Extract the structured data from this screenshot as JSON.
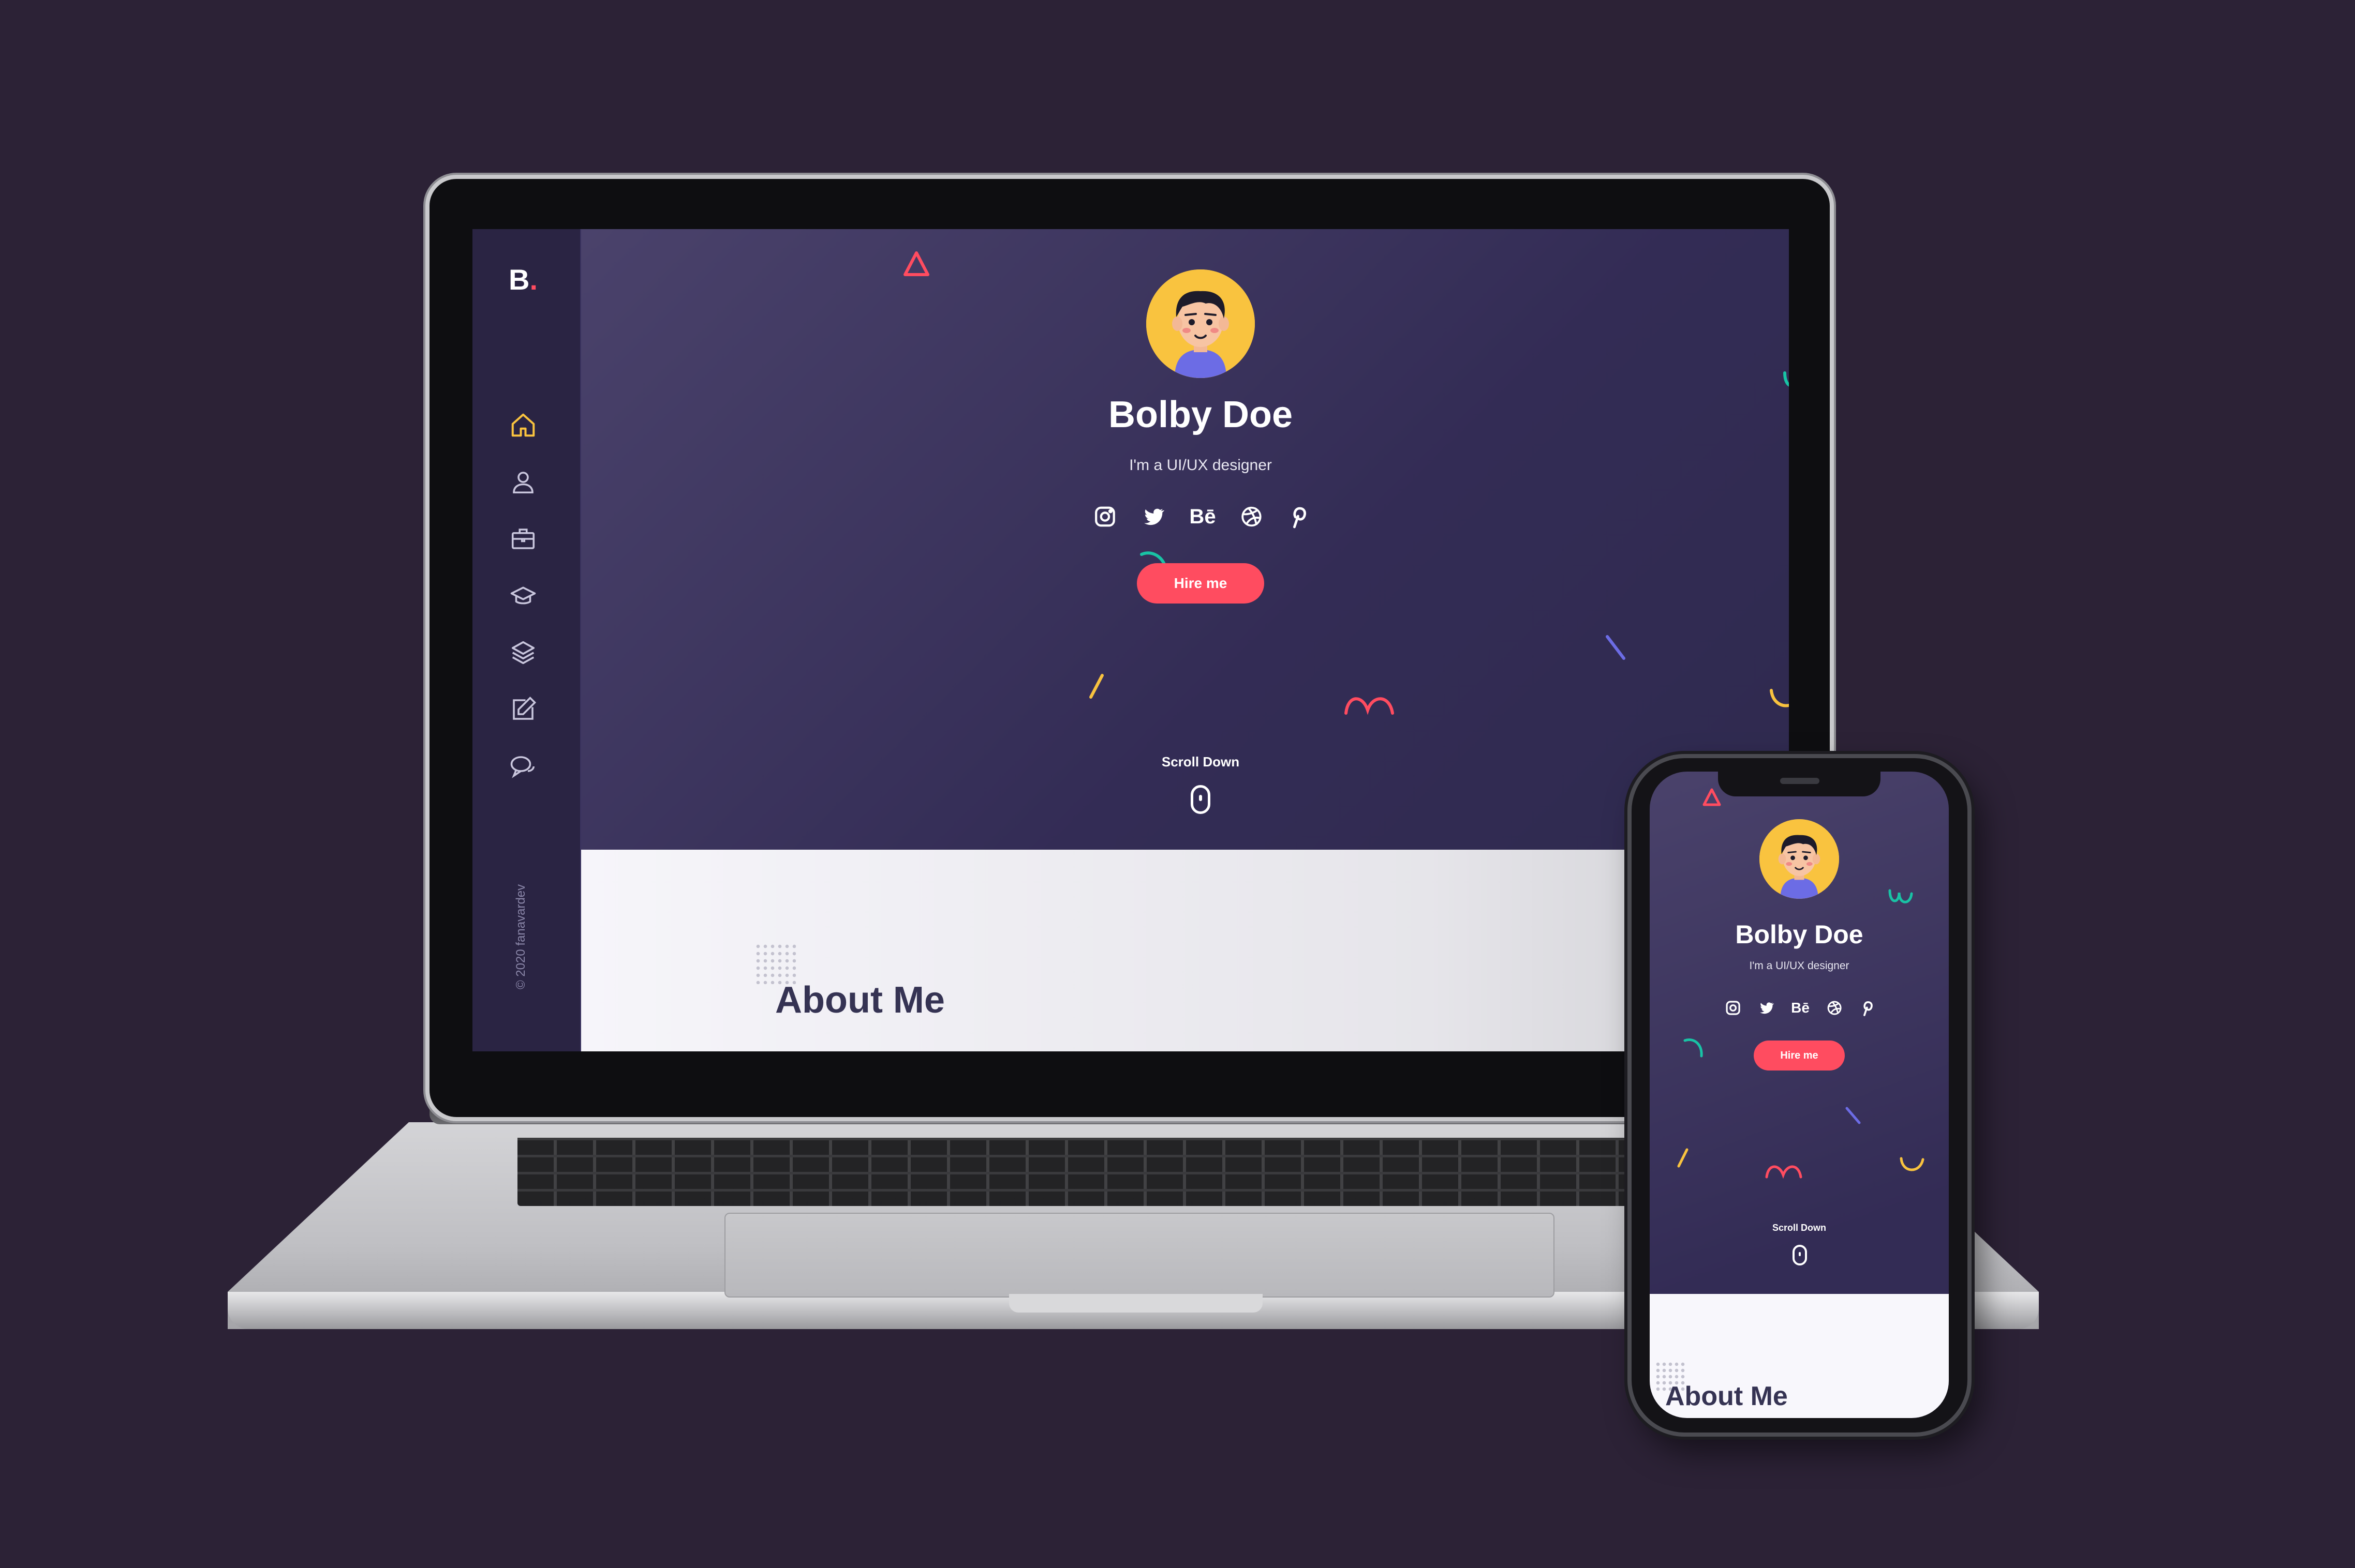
{
  "site": {
    "logo": "B",
    "logo_dot": ".",
    "copyright": "© 2020 fanavardev",
    "nav": [
      {
        "id": "home",
        "icon": "home-icon"
      },
      {
        "id": "about",
        "icon": "user-icon"
      },
      {
        "id": "services",
        "icon": "briefcase-icon"
      },
      {
        "id": "experience",
        "icon": "graduation-cap-icon"
      },
      {
        "id": "works",
        "icon": "layers-icon"
      },
      {
        "id": "blog",
        "icon": "edit-icon"
      },
      {
        "id": "contact",
        "icon": "chat-icon"
      }
    ],
    "hero": {
      "name": "Bolby Doe",
      "subtitle": "I'm a UI/UX designer",
      "social": [
        {
          "id": "instagram",
          "icon": "instagram-icon"
        },
        {
          "id": "twitter",
          "icon": "twitter-icon"
        },
        {
          "id": "behance",
          "icon": "behance-icon",
          "text": "Bē"
        },
        {
          "id": "dribbble",
          "icon": "dribbble-icon"
        },
        {
          "id": "pinterest",
          "icon": "pinterest-icon"
        }
      ],
      "hire_button": "Hire me",
      "scroll_label": "Scroll Down"
    },
    "about_title": "About Me"
  },
  "colors": {
    "background": "#2c2236",
    "accent": "#ff4c60",
    "hero_bg": "#332c55",
    "avatar_bg": "#f9c33f",
    "shape_teal": "#19c3a5",
    "shape_yellow": "#f9c33f",
    "shape_purple": "#6c6ce5"
  }
}
